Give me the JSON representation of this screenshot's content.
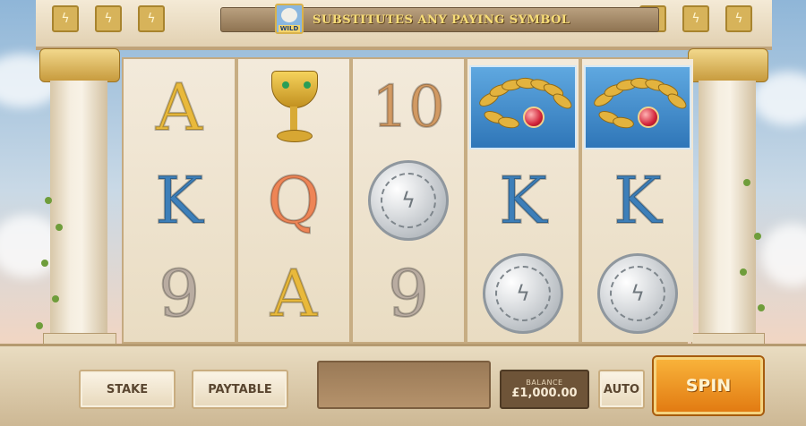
{
  "banner": {
    "wild_label": "WILD",
    "text": "SUBSTITUTES ANY PAYING SYMBOL"
  },
  "reels": [
    [
      "A",
      "K",
      "9"
    ],
    [
      "goblet",
      "Q",
      "A"
    ],
    [
      "10",
      "coin",
      "9"
    ],
    [
      "laurel",
      "K",
      "coin"
    ],
    [
      "laurel",
      "K",
      "coin"
    ]
  ],
  "controls": {
    "stake_label": "STAKE",
    "paytable_label": "PAYTABLE",
    "balance_label": "BALANCE",
    "balance_value": "£1,000.00",
    "auto_label": "AUTO",
    "spin_label": "SPIN"
  },
  "colors": {
    "A": "#e9b93b",
    "K": "#3d7fb9",
    "Q": "#ee8556",
    "9": "#b9aca1",
    "10": "#d29a63",
    "spin": "#f08f1c"
  }
}
